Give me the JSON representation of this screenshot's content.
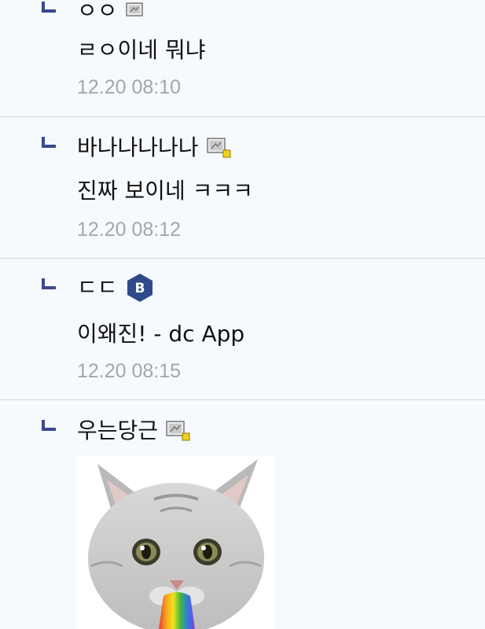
{
  "colors": {
    "background": "#f6f9fd",
    "divider": "#d6dae0",
    "reply_arrow": "#3b4890",
    "timestamp": "#a3a7ad",
    "badge_b": "#2f4a8a"
  },
  "replies": [
    {
      "nickname": "ㅇㅇ",
      "badge_icon": "fixed-nick-icon",
      "content": "ㄹㅇ이네 뭐냐",
      "time": "12.20 08:10"
    },
    {
      "nickname": "바나나나나나",
      "badge_icon": "fixed-nick-icon",
      "content": "진짜 보이네 ㅋㅋㅋ",
      "time": "12.20 08:12"
    },
    {
      "nickname": "ㄷㄷ",
      "badge_icon": "b-badge-icon",
      "badge_letter": "B",
      "content": "이왜진! - dc App",
      "time": "12.20 08:15"
    },
    {
      "nickname": "우는당근",
      "badge_icon": "fixed-nick-icon",
      "content_type": "dccon-image",
      "image_subject": "crying-rainbow-cat-icon"
    }
  ]
}
